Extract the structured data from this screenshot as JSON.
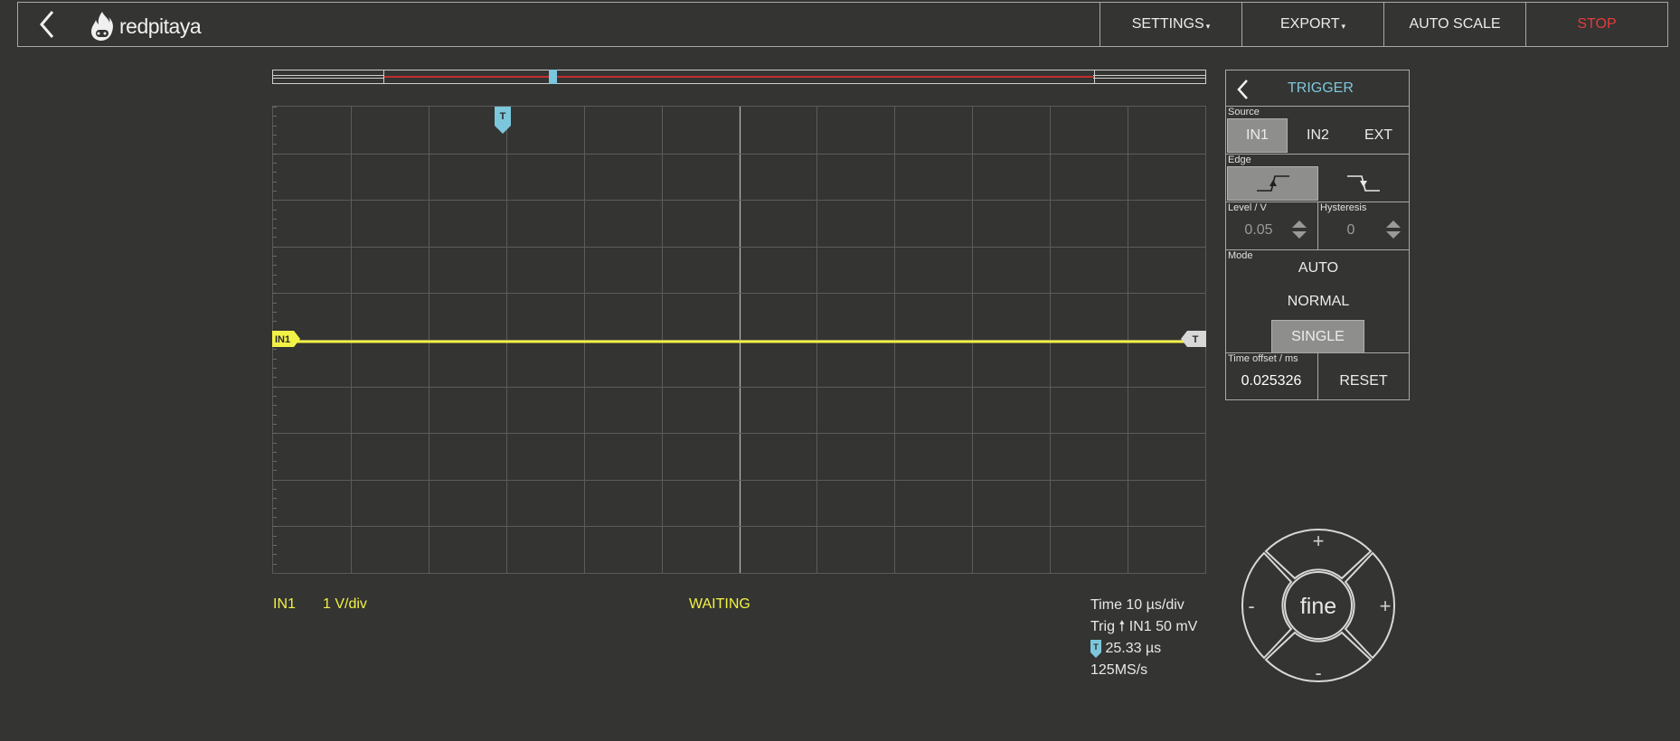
{
  "topbar": {
    "logo_text": "redpitaya",
    "menu": {
      "settings": "SETTINGS",
      "export": "EXPORT",
      "autoscale": "AUTO SCALE",
      "stop": "STOP"
    }
  },
  "graph": {
    "channel_marker": "IN1",
    "trigger_marker": "T",
    "signal_level_div": 0
  },
  "status": {
    "channel": "IN1",
    "scale": "1 V/div",
    "state": "WAITING",
    "time": "Time 10 µs/div",
    "trig": "Trig",
    "trig_source": "IN1 50 mV",
    "t_offset": "25.33 µs",
    "sample_rate": "125MS/s"
  },
  "trigger_panel": {
    "title": "TRIGGER",
    "source_label": "Source",
    "sources": [
      "IN1",
      "IN2",
      "EXT"
    ],
    "source_selected": "IN1",
    "edge_label": "Edge",
    "edge_selected": "rising",
    "level_label": "Level / V",
    "level_value": "0.05",
    "hysteresis_label": "Hysteresis",
    "hysteresis_value": "0",
    "mode_label": "Mode",
    "modes": [
      "AUTO",
      "NORMAL",
      "SINGLE"
    ],
    "mode_selected": "SINGLE",
    "time_offset_label": "Time offset / ms",
    "time_offset_value": "0.025326",
    "reset": "RESET"
  },
  "joystick": {
    "center": "fine",
    "up": "+",
    "down": "-",
    "left": "-",
    "right": "+"
  },
  "colors": {
    "background": "#343432",
    "channel1": "#f2f246",
    "trigger": "#7dc7dc",
    "stop": "#e43c3c"
  }
}
